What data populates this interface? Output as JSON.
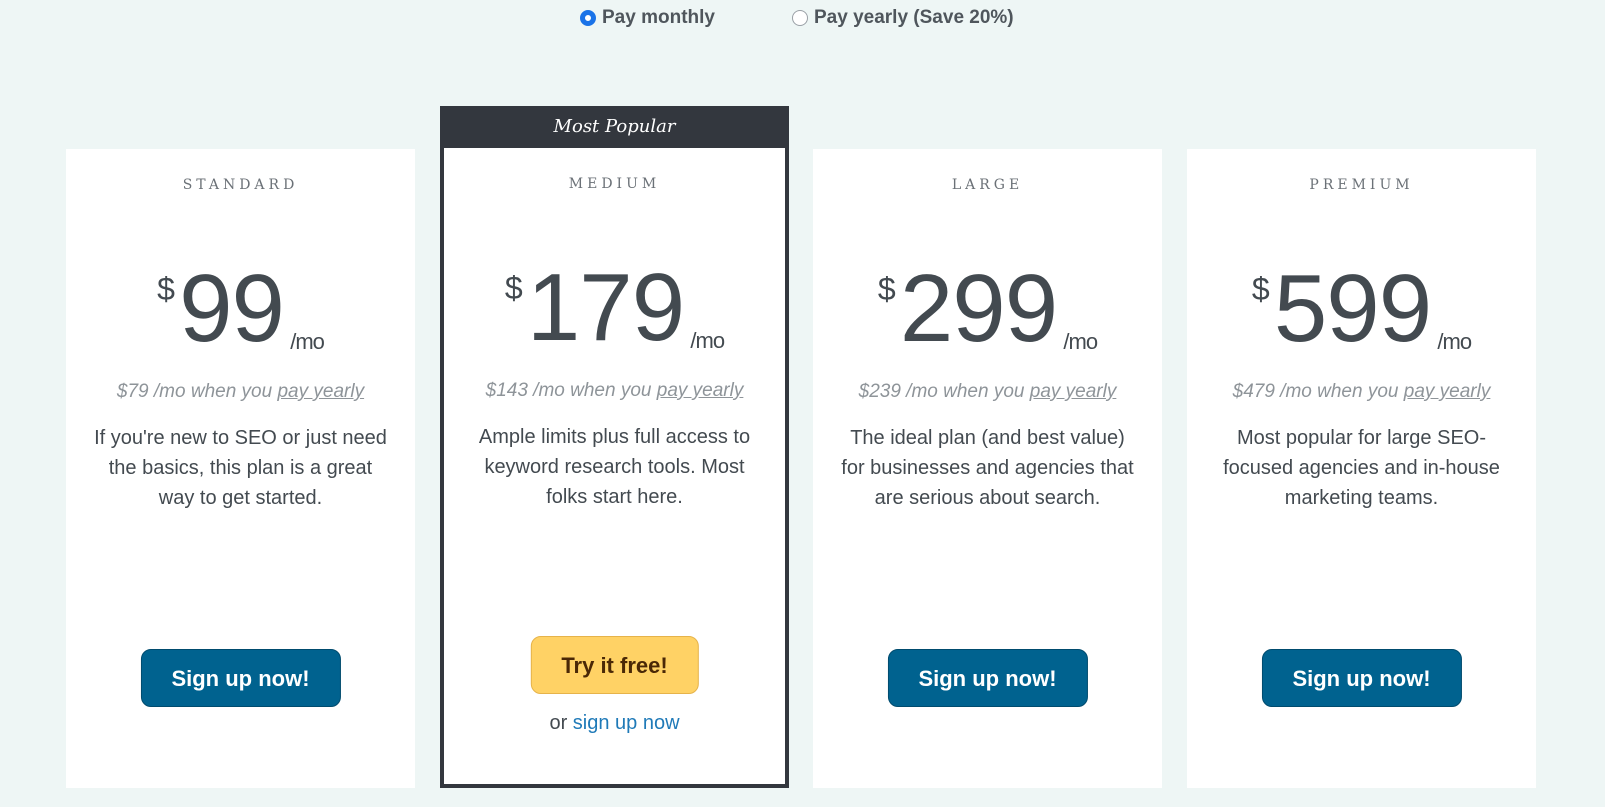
{
  "billing_toggle": {
    "options": [
      {
        "label": "Pay monthly",
        "checked": true
      },
      {
        "label": "Pay yearly (Save 20%)",
        "checked": false
      }
    ]
  },
  "plans": [
    {
      "name": "STANDARD",
      "currency": "$",
      "price": "99",
      "per": "/mo",
      "yearly_prefix": "$79 /mo when you ",
      "yearly_link": "pay yearly",
      "description": "If you're new to SEO or just need the basics, this plan is a great way to get started.",
      "cta": "Sign up now!"
    },
    {
      "name": "MEDIUM",
      "badge": "Most Popular",
      "currency": "$",
      "price": "179",
      "per": "/mo",
      "yearly_prefix": "$143 /mo when you ",
      "yearly_link": "pay yearly",
      "description": "Ample limits plus full access to keyword research tools. Most folks start here.",
      "cta": "Try it free!",
      "alt_prefix": "or ",
      "alt_link": "sign up now"
    },
    {
      "name": "LARGE",
      "currency": "$",
      "price": "299",
      "per": "/mo",
      "yearly_prefix": "$239 /mo when you ",
      "yearly_link": "pay yearly",
      "description": "The ideal plan (and best value) for businesses and agencies that are serious about search.",
      "cta": "Sign up now!"
    },
    {
      "name": "PREMIUM",
      "currency": "$",
      "price": "599",
      "per": "/mo",
      "yearly_prefix": "$479 /mo when you ",
      "yearly_link": "pay yearly",
      "description": "Most popular for large SEO-focused agencies and in-house marketing teams.",
      "cta": "Sign up now!"
    }
  ],
  "colors": {
    "background": "#eef6f5",
    "primary_button": "#00628f",
    "trial_button": "#ffd265",
    "featured_border": "#33373e",
    "link": "#1f7ab8",
    "radio_checked": "#1a73e8"
  }
}
